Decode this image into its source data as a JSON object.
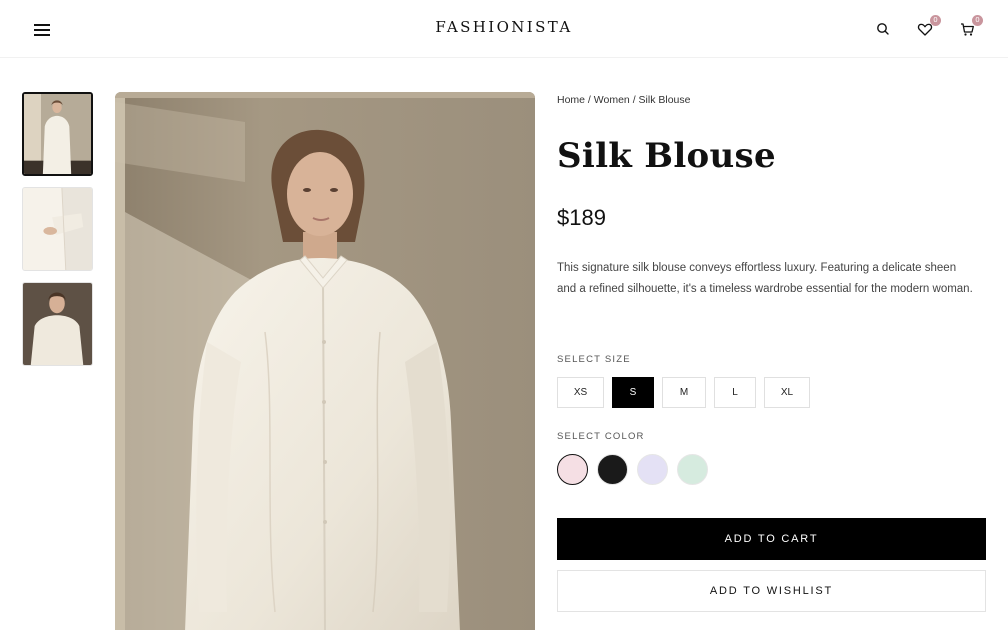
{
  "brand": "FASHIONISTA",
  "header": {
    "wishlist_count": "0",
    "cart_count": "0",
    "badge_color": "#c9959d"
  },
  "breadcrumb": {
    "home": "Home",
    "sep1": " / ",
    "category": "Women",
    "sep2": " / ",
    "current": "Silk Blouse"
  },
  "product": {
    "title": "Silk Blouse",
    "price": "$189",
    "description": "This signature silk blouse conveys effortless luxury. Featuring a delicate sheen and a refined silhouette, it's a timeless wardrobe essential for the modern woman."
  },
  "size": {
    "label": "SELECT SIZE",
    "options": [
      "XS",
      "S",
      "M",
      "L",
      "XL"
    ],
    "selected": "S"
  },
  "color": {
    "label": "SELECT COLOR",
    "swatches": [
      "#f5dfe4",
      "#1a1a1a",
      "#e4e1f5",
      "#d6ebdf"
    ],
    "selected_index": 0
  },
  "actions": {
    "add_to_cart": "ADD TO CART",
    "add_to_wishlist": "ADD TO WISHLIST"
  },
  "icons": {
    "menu": "hamburger-menu-icon",
    "search": "search-icon",
    "wishlist": "heart-icon",
    "cart": "cart-icon"
  },
  "gallery": {
    "thumbnails": [
      "full-length-front-view",
      "sleeve-cuff-detail",
      "upper-body-front-view"
    ],
    "active_index": 0
  }
}
